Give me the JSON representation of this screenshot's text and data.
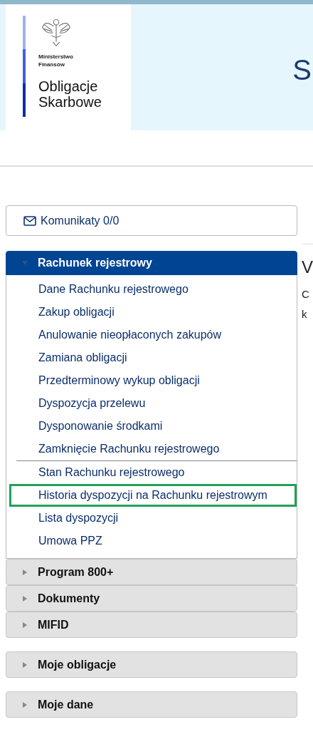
{
  "header": {
    "ministry": "Ministerstwo\nFinansów",
    "brand": "Obligacje\nSkarbowe",
    "title_fragment": "S"
  },
  "messages_button": {
    "label": "Komunikaty 0/0"
  },
  "menu_blocks": [
    [
      {
        "label": "Rachunek rejestrowy",
        "expanded": true,
        "sections": [
          [
            {
              "label": "Dane Rachunku rejestrowego",
              "selected": false
            },
            {
              "label": "Zakup obligacji",
              "selected": false
            },
            {
              "label": "Anulowanie nieopłaconych zakupów",
              "selected": false
            },
            {
              "label": "Zamiana obligacji",
              "selected": false
            },
            {
              "label": "Przedterminowy wykup obligacji",
              "selected": false
            },
            {
              "label": "Dyspozycja przelewu",
              "selected": false
            },
            {
              "label": "Dysponowanie środkami",
              "selected": false
            },
            {
              "label": "Zamknięcie Rachunku rejestrowego",
              "selected": false
            }
          ],
          [
            {
              "label": "Stan Rachunku rejestrowego",
              "selected": false
            },
            {
              "label": "Historia dyspozycji na Rachunku rejestrowym",
              "selected": true
            },
            {
              "label": "Lista dyspozycji",
              "selected": false
            },
            {
              "label": "Umowa PPZ",
              "selected": false
            }
          ]
        ]
      },
      {
        "label": "Program 800+",
        "expanded": false
      },
      {
        "label": "Dokumenty",
        "expanded": false
      },
      {
        "label": "MIFID",
        "expanded": false
      }
    ],
    [
      {
        "label": "Moje obligacje",
        "expanded": false
      }
    ],
    [
      {
        "label": "Moje dane",
        "expanded": false
      }
    ]
  ],
  "content_fragments": {
    "heading": "V",
    "lines": [
      "C",
      "k"
    ]
  }
}
